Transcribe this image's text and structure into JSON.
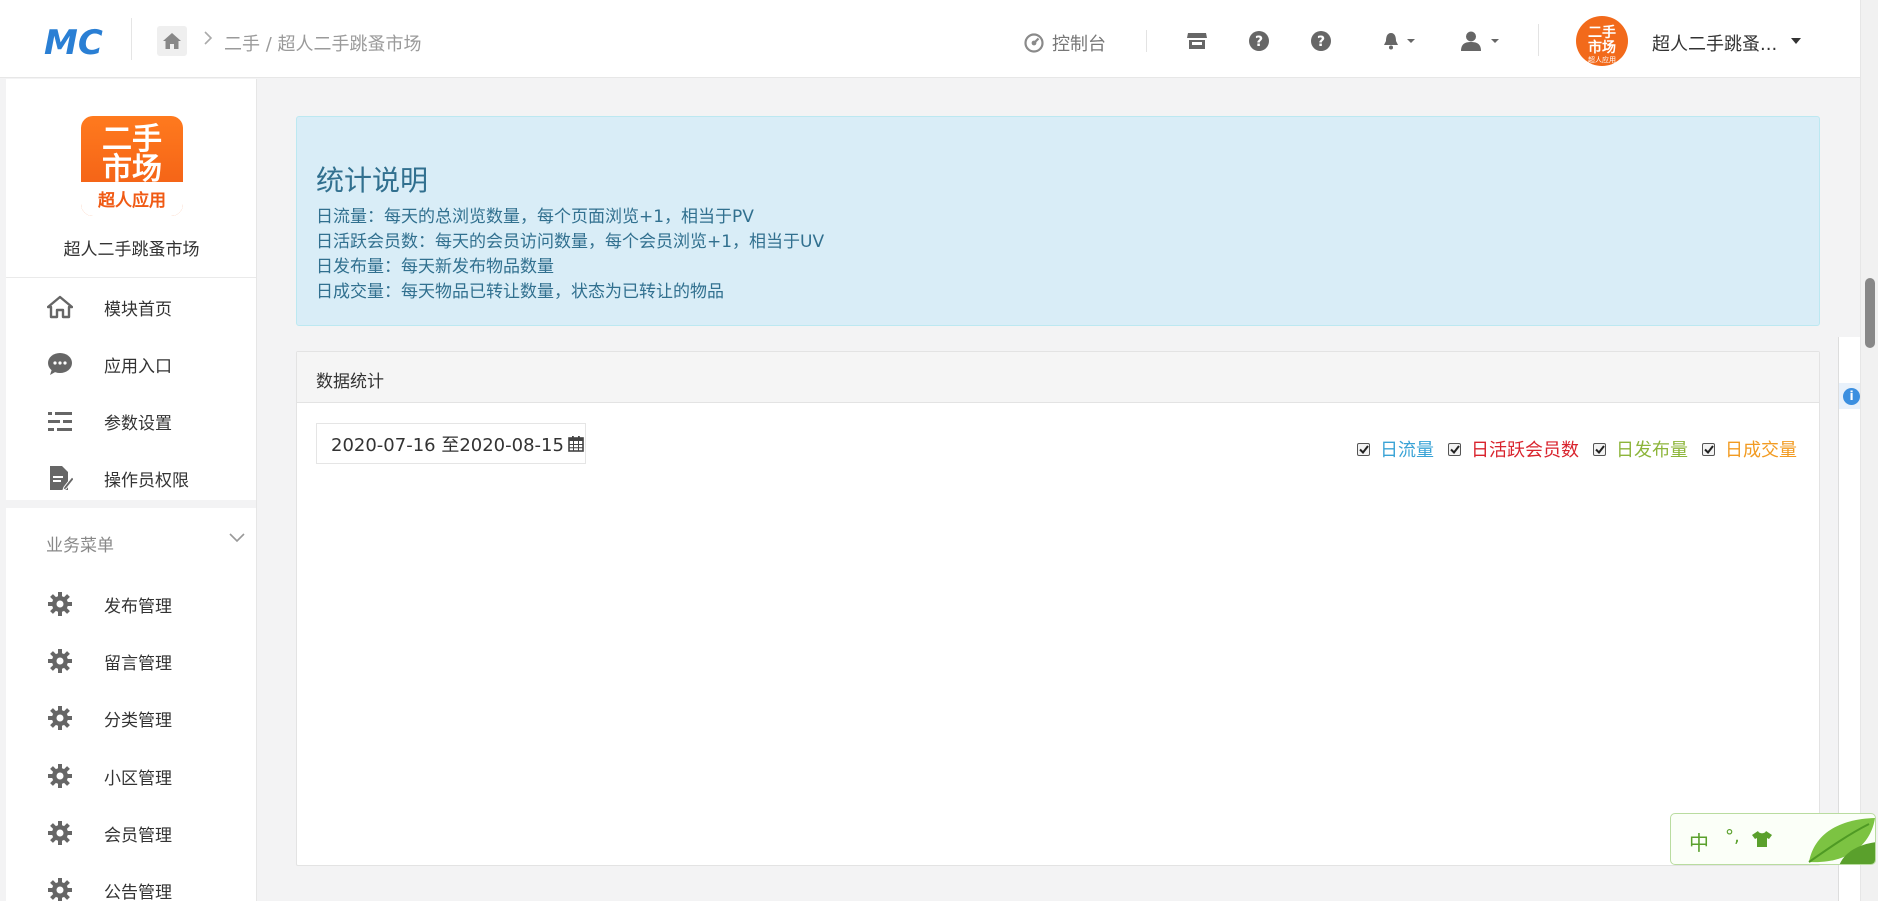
{
  "header": {
    "breadcrumb": "二手 / 超人二手跳蚤市场",
    "console_label": "控制台",
    "user_name": "超人二手跳蚤...",
    "logo_text": "MC"
  },
  "sidebar": {
    "app_name": "超人二手跳蚤市场",
    "logo_line1": "二手",
    "logo_line2": "市场",
    "logo_line3": "超人应用",
    "main_menu": [
      {
        "label": "模块首页",
        "icon": "home-icon"
      },
      {
        "label": "应用入口",
        "icon": "chat-icon"
      },
      {
        "label": "参数设置",
        "icon": "sliders-icon"
      },
      {
        "label": "操作员权限",
        "icon": "document-edit-icon"
      }
    ],
    "section_title": "业务菜单",
    "business_menu": [
      {
        "label": "发布管理",
        "icon": "gear-icon"
      },
      {
        "label": "留言管理",
        "icon": "gear-icon"
      },
      {
        "label": "分类管理",
        "icon": "gear-icon"
      },
      {
        "label": "小区管理",
        "icon": "gear-icon"
      },
      {
        "label": "会员管理",
        "icon": "gear-icon"
      },
      {
        "label": "公告管理",
        "icon": "gear-icon"
      }
    ]
  },
  "info": {
    "title": "统计说明",
    "lines": [
      "日流量：每天的总浏览数量，每个页面浏览+1，相当于PV",
      "日活跃会员数：每天的会员访问数量，每个会员浏览+1，相当于UV",
      "日发布量：每天新发布物品数量",
      "日成交量：每天物品已转让数量，状态为已转让的物品"
    ]
  },
  "stats": {
    "panel_title": "数据统计",
    "date_range": "2020-07-16 至2020-08-15",
    "legend": [
      {
        "label": "日流量",
        "color": "#3aa3d6",
        "checked": true
      },
      {
        "label": "日活跃会员数",
        "color": "#d9232d",
        "checked": true
      },
      {
        "label": "日发布量",
        "color": "#8db53b",
        "checked": true
      },
      {
        "label": "日成交量",
        "color": "#f29b22",
        "checked": true
      }
    ]
  },
  "edge": {
    "info_glyph": "i"
  },
  "ime": {
    "lang": "中",
    "punct": "°,"
  },
  "colors": {
    "brand_blue": "#2a7fd4",
    "brand_orange": "#f26a1b",
    "info_text": "#31708f"
  }
}
